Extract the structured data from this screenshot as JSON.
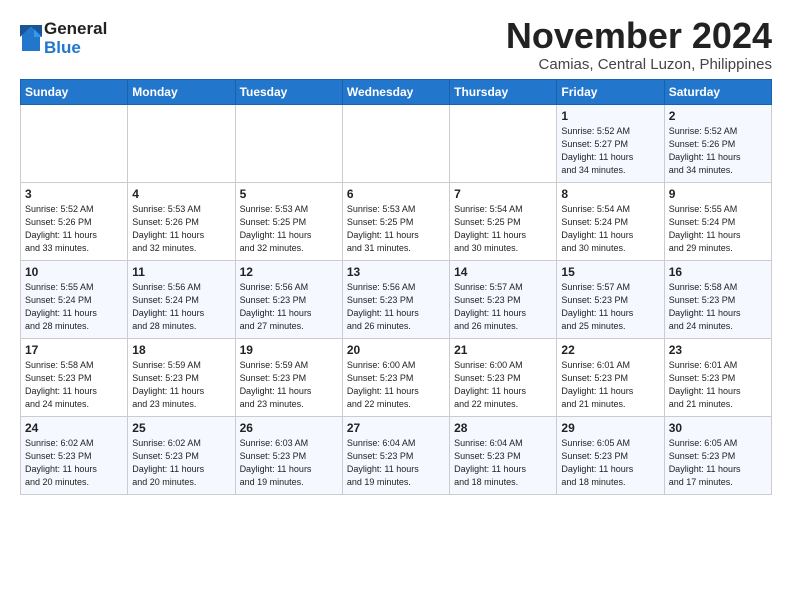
{
  "logo": {
    "general": "General",
    "blue": "Blue"
  },
  "title": "November 2024",
  "location": "Camias, Central Luzon, Philippines",
  "weekdays": [
    "Sunday",
    "Monday",
    "Tuesday",
    "Wednesday",
    "Thursday",
    "Friday",
    "Saturday"
  ],
  "weeks": [
    [
      {
        "day": "",
        "info": ""
      },
      {
        "day": "",
        "info": ""
      },
      {
        "day": "",
        "info": ""
      },
      {
        "day": "",
        "info": ""
      },
      {
        "day": "",
        "info": ""
      },
      {
        "day": "1",
        "info": "Sunrise: 5:52 AM\nSunset: 5:27 PM\nDaylight: 11 hours\nand 34 minutes."
      },
      {
        "day": "2",
        "info": "Sunrise: 5:52 AM\nSunset: 5:26 PM\nDaylight: 11 hours\nand 34 minutes."
      }
    ],
    [
      {
        "day": "3",
        "info": "Sunrise: 5:52 AM\nSunset: 5:26 PM\nDaylight: 11 hours\nand 33 minutes."
      },
      {
        "day": "4",
        "info": "Sunrise: 5:53 AM\nSunset: 5:26 PM\nDaylight: 11 hours\nand 32 minutes."
      },
      {
        "day": "5",
        "info": "Sunrise: 5:53 AM\nSunset: 5:25 PM\nDaylight: 11 hours\nand 32 minutes."
      },
      {
        "day": "6",
        "info": "Sunrise: 5:53 AM\nSunset: 5:25 PM\nDaylight: 11 hours\nand 31 minutes."
      },
      {
        "day": "7",
        "info": "Sunrise: 5:54 AM\nSunset: 5:25 PM\nDaylight: 11 hours\nand 30 minutes."
      },
      {
        "day": "8",
        "info": "Sunrise: 5:54 AM\nSunset: 5:24 PM\nDaylight: 11 hours\nand 30 minutes."
      },
      {
        "day": "9",
        "info": "Sunrise: 5:55 AM\nSunset: 5:24 PM\nDaylight: 11 hours\nand 29 minutes."
      }
    ],
    [
      {
        "day": "10",
        "info": "Sunrise: 5:55 AM\nSunset: 5:24 PM\nDaylight: 11 hours\nand 28 minutes."
      },
      {
        "day": "11",
        "info": "Sunrise: 5:56 AM\nSunset: 5:24 PM\nDaylight: 11 hours\nand 28 minutes."
      },
      {
        "day": "12",
        "info": "Sunrise: 5:56 AM\nSunset: 5:23 PM\nDaylight: 11 hours\nand 27 minutes."
      },
      {
        "day": "13",
        "info": "Sunrise: 5:56 AM\nSunset: 5:23 PM\nDaylight: 11 hours\nand 26 minutes."
      },
      {
        "day": "14",
        "info": "Sunrise: 5:57 AM\nSunset: 5:23 PM\nDaylight: 11 hours\nand 26 minutes."
      },
      {
        "day": "15",
        "info": "Sunrise: 5:57 AM\nSunset: 5:23 PM\nDaylight: 11 hours\nand 25 minutes."
      },
      {
        "day": "16",
        "info": "Sunrise: 5:58 AM\nSunset: 5:23 PM\nDaylight: 11 hours\nand 24 minutes."
      }
    ],
    [
      {
        "day": "17",
        "info": "Sunrise: 5:58 AM\nSunset: 5:23 PM\nDaylight: 11 hours\nand 24 minutes."
      },
      {
        "day": "18",
        "info": "Sunrise: 5:59 AM\nSunset: 5:23 PM\nDaylight: 11 hours\nand 23 minutes."
      },
      {
        "day": "19",
        "info": "Sunrise: 5:59 AM\nSunset: 5:23 PM\nDaylight: 11 hours\nand 23 minutes."
      },
      {
        "day": "20",
        "info": "Sunrise: 6:00 AM\nSunset: 5:23 PM\nDaylight: 11 hours\nand 22 minutes."
      },
      {
        "day": "21",
        "info": "Sunrise: 6:00 AM\nSunset: 5:23 PM\nDaylight: 11 hours\nand 22 minutes."
      },
      {
        "day": "22",
        "info": "Sunrise: 6:01 AM\nSunset: 5:23 PM\nDaylight: 11 hours\nand 21 minutes."
      },
      {
        "day": "23",
        "info": "Sunrise: 6:01 AM\nSunset: 5:23 PM\nDaylight: 11 hours\nand 21 minutes."
      }
    ],
    [
      {
        "day": "24",
        "info": "Sunrise: 6:02 AM\nSunset: 5:23 PM\nDaylight: 11 hours\nand 20 minutes."
      },
      {
        "day": "25",
        "info": "Sunrise: 6:02 AM\nSunset: 5:23 PM\nDaylight: 11 hours\nand 20 minutes."
      },
      {
        "day": "26",
        "info": "Sunrise: 6:03 AM\nSunset: 5:23 PM\nDaylight: 11 hours\nand 19 minutes."
      },
      {
        "day": "27",
        "info": "Sunrise: 6:04 AM\nSunset: 5:23 PM\nDaylight: 11 hours\nand 19 minutes."
      },
      {
        "day": "28",
        "info": "Sunrise: 6:04 AM\nSunset: 5:23 PM\nDaylight: 11 hours\nand 18 minutes."
      },
      {
        "day": "29",
        "info": "Sunrise: 6:05 AM\nSunset: 5:23 PM\nDaylight: 11 hours\nand 18 minutes."
      },
      {
        "day": "30",
        "info": "Sunrise: 6:05 AM\nSunset: 5:23 PM\nDaylight: 11 hours\nand 17 minutes."
      }
    ]
  ]
}
